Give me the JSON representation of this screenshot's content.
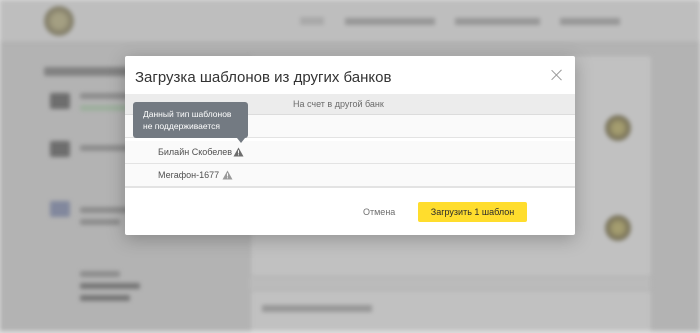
{
  "modal": {
    "title": "Загрузка шаблонов из других банков",
    "table_header": "На счет в другой банк",
    "tooltip": {
      "line1": "Данный тип шаблонов",
      "line2": "не поддерживается"
    },
    "rows": [
      {
        "label": "Билайн Скобелев",
        "icon": "warning-icon"
      },
      {
        "label": "Мегафон-1677",
        "icon": "warning-icon"
      }
    ],
    "cancel_label": "Отмена",
    "submit_label": "Загрузить 1 шаблон"
  },
  "colors": {
    "accent": "#ffdd2d",
    "tooltip_bg": "#737a82",
    "overlay": "rgba(70,70,70,0.28)"
  }
}
